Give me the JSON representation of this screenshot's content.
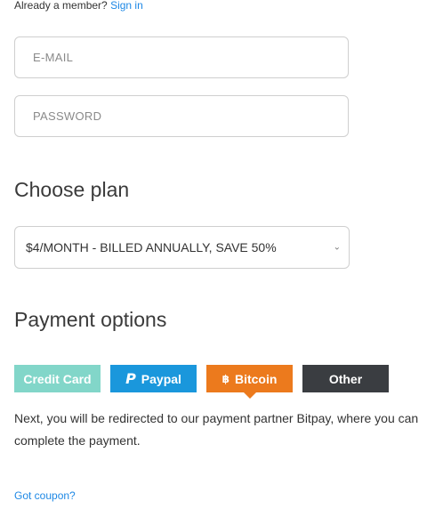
{
  "header": {
    "member_prompt": "Already a member?",
    "sign_in_link": "Sign in"
  },
  "form": {
    "email_placeholder": "E-MAIL",
    "password_placeholder": "PASSWORD"
  },
  "plan": {
    "title": "Choose plan",
    "selected_option": "$4/MONTH - BILLED ANNUALLY, SAVE 50%"
  },
  "payment": {
    "title": "Payment options",
    "methods": [
      {
        "label": "Credit Card",
        "color": "#82d6c9"
      },
      {
        "label": "Paypal",
        "color": "#1a97dc",
        "icon": "paypal-icon"
      },
      {
        "label": "Bitcoin",
        "color": "#ec7a1d",
        "icon": "bitcoin-icon",
        "selected": true
      },
      {
        "label": "Other",
        "color": "#3a3d41"
      }
    ],
    "note": "Next, you will be redirected to our payment partner Bitpay, where you can complete the payment."
  },
  "coupon_link": "Got coupon?"
}
